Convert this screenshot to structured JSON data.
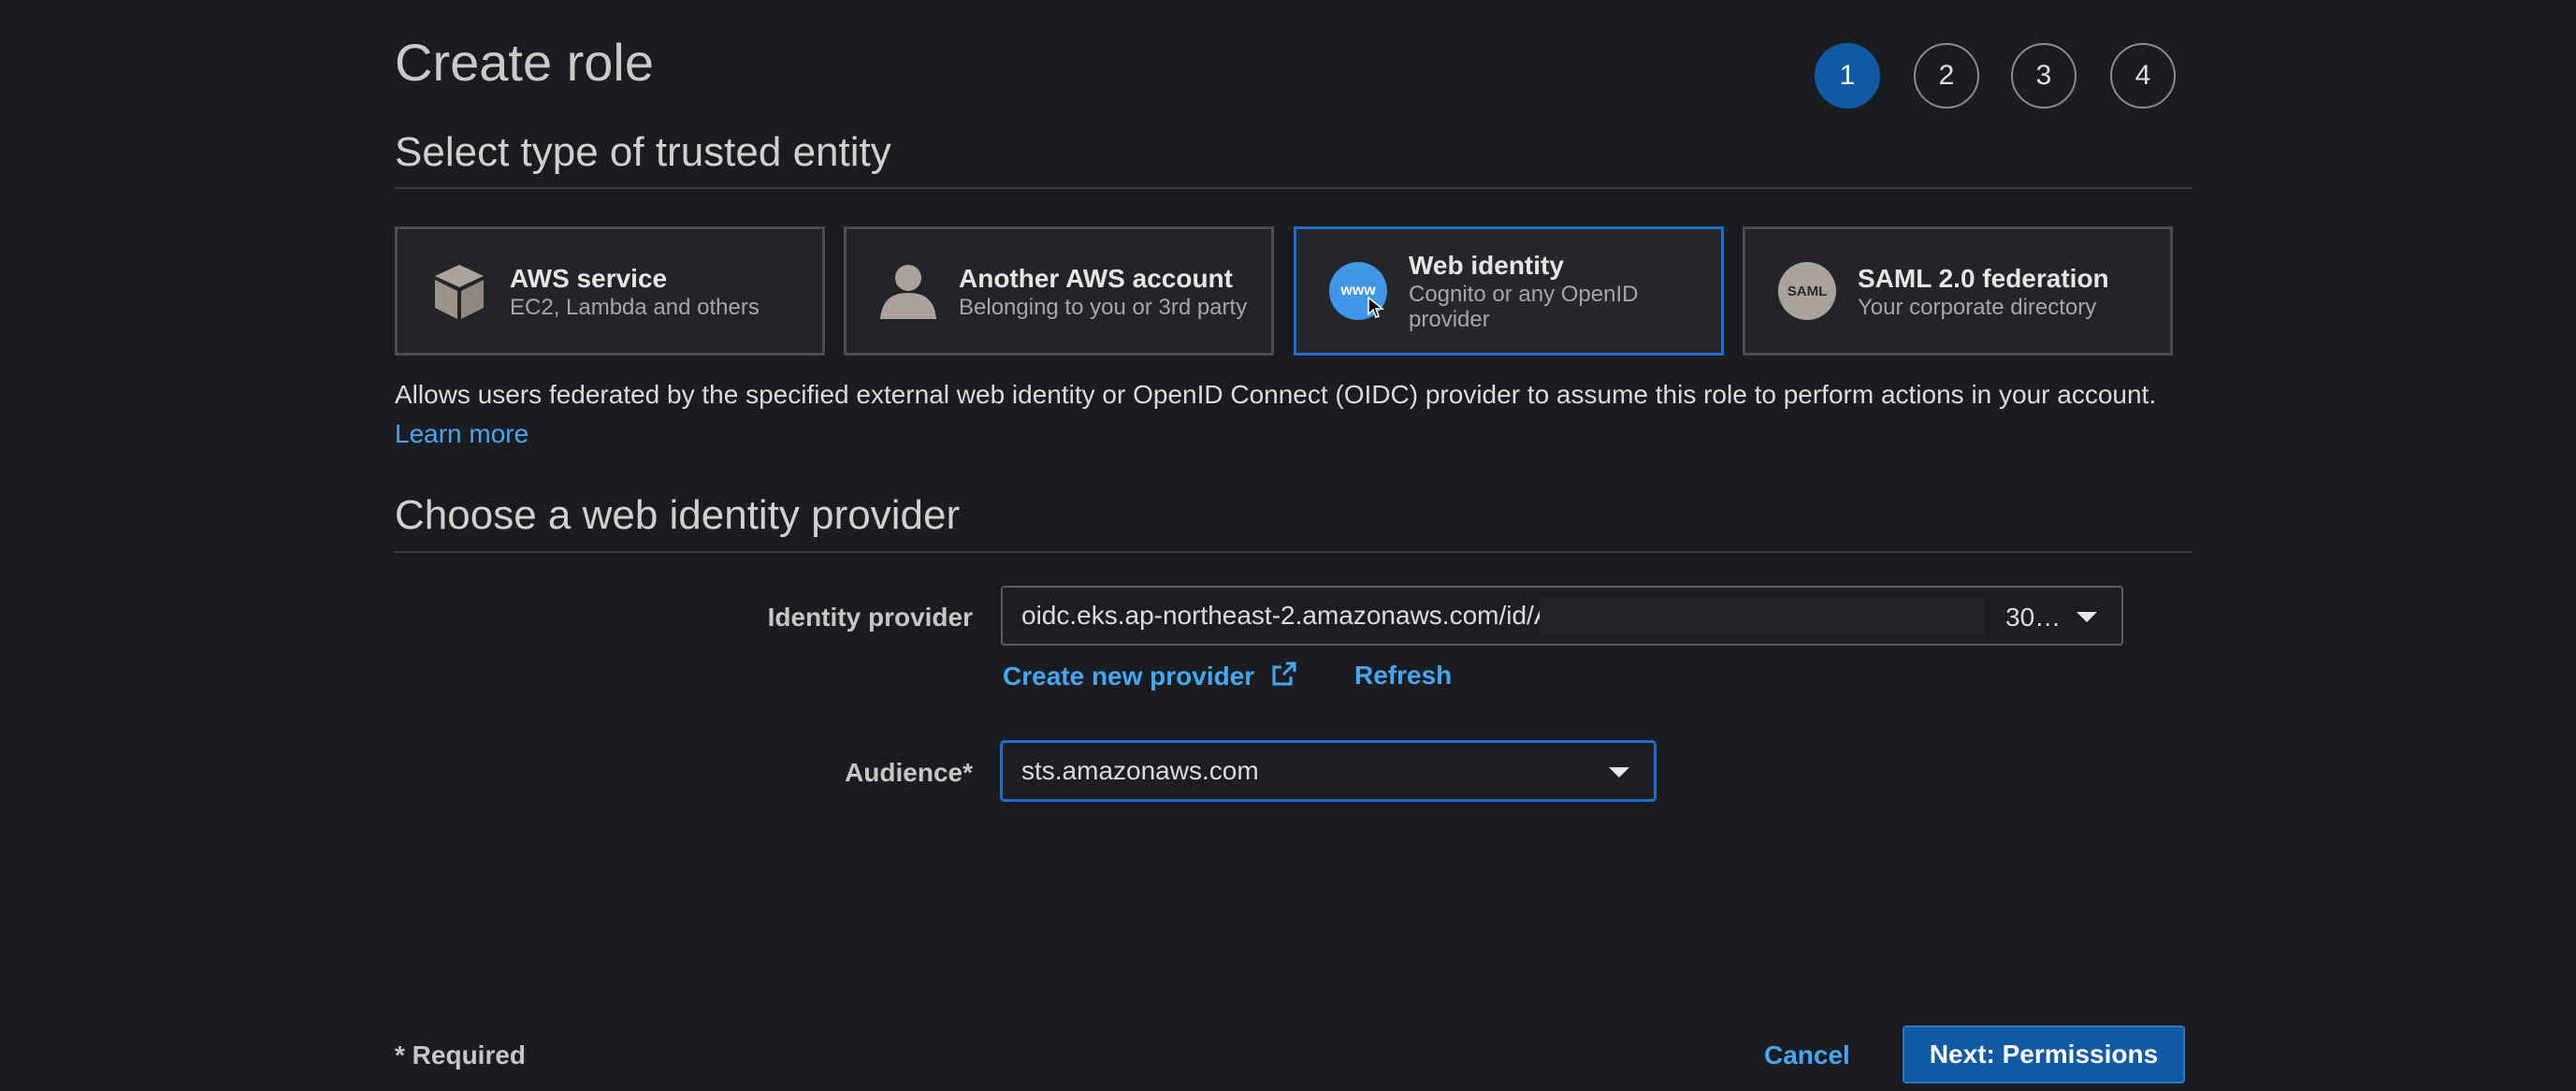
{
  "page": {
    "title": "Create role",
    "steps": [
      "1",
      "2",
      "3",
      "4"
    ],
    "active_step": "1"
  },
  "entity_section": {
    "title": "Select type of trusted entity",
    "cards": [
      {
        "title": "AWS service",
        "subtitle": "EC2, Lambda and others",
        "icon": "box-icon"
      },
      {
        "title": "Another AWS account",
        "subtitle": "Belonging to you or 3rd party",
        "icon": "user-icon"
      },
      {
        "title": "Web identity",
        "subtitle": "Cognito or any OpenID provider",
        "icon": "www-icon",
        "icon_text": "www",
        "selected": true
      },
      {
        "title": "SAML 2.0 federation",
        "subtitle": "Your corporate directory",
        "icon": "saml-icon",
        "icon_text": "SAML"
      }
    ],
    "description": "Allows users federated by the specified external web identity or OpenID Connect (OIDC) provider to assume this role to perform actions in your account.",
    "learn_more": "Learn more"
  },
  "provider_section": {
    "title": "Choose a web identity provider",
    "identity_provider": {
      "label": "Identity provider",
      "value_prefix": "oidc.eks.ap-northeast-2.amazonaws.com/id/A",
      "value_suffix": "30…"
    },
    "create_new_provider": "Create new provider",
    "refresh": "Refresh",
    "audience": {
      "label": "Audience*",
      "value": "sts.amazonaws.com"
    }
  },
  "footer": {
    "required_note": "* Required",
    "cancel": "Cancel",
    "next": "Next: Permissions"
  },
  "colors": {
    "background": "#1b1c1f",
    "accent": "#0f5aa3",
    "link": "#44a7f5",
    "selected_border": "#1b6fd0"
  }
}
